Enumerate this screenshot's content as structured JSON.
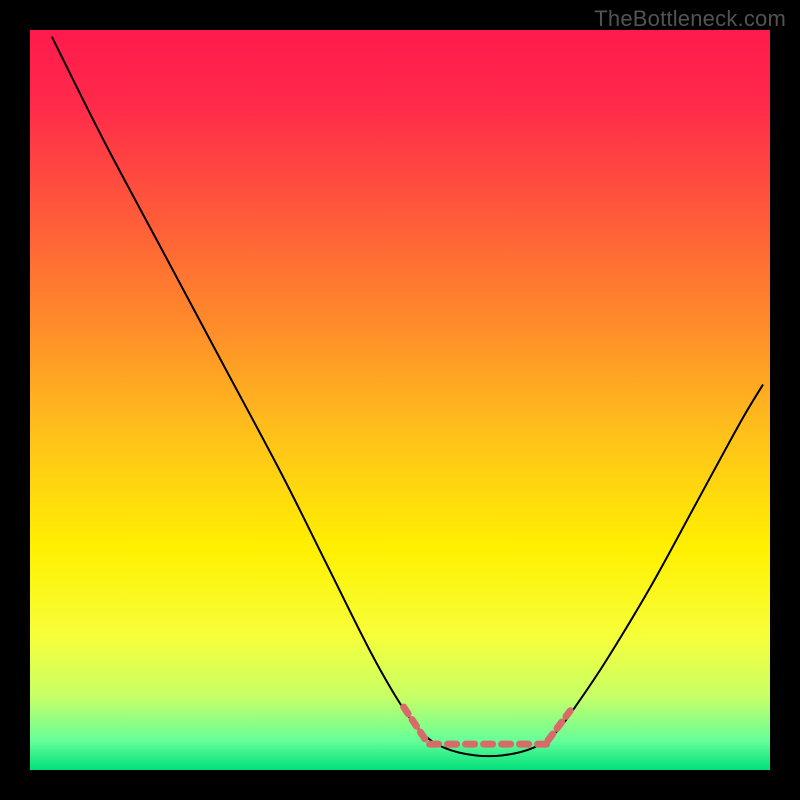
{
  "watermark": "TheBottleneck.com",
  "colors": {
    "gradient_stops": [
      {
        "offset": 0.0,
        "color": "#ff1a4d"
      },
      {
        "offset": 0.1,
        "color": "#ff2a4a"
      },
      {
        "offset": 0.25,
        "color": "#ff5a3a"
      },
      {
        "offset": 0.4,
        "color": "#ff8c2a"
      },
      {
        "offset": 0.55,
        "color": "#ffc21a"
      },
      {
        "offset": 0.7,
        "color": "#fff000"
      },
      {
        "offset": 0.82,
        "color": "#f6ff3a"
      },
      {
        "offset": 0.9,
        "color": "#c8ff66"
      },
      {
        "offset": 0.96,
        "color": "#66ff99"
      },
      {
        "offset": 1.0,
        "color": "#00e07a"
      }
    ],
    "curve": "#000000",
    "overlay_marker": "#d86a6a",
    "frame": "#000000"
  },
  "chart_data": {
    "type": "line",
    "title": "",
    "xlabel": "",
    "ylabel": "",
    "xlim": [
      0,
      100
    ],
    "ylim": [
      0,
      100
    ],
    "series": [
      {
        "name": "bottleneck-curve",
        "points": [
          {
            "x": 3,
            "y": 99
          },
          {
            "x": 10,
            "y": 85
          },
          {
            "x": 18,
            "y": 70
          },
          {
            "x": 26,
            "y": 55
          },
          {
            "x": 34,
            "y": 40
          },
          {
            "x": 40,
            "y": 28
          },
          {
            "x": 46,
            "y": 16
          },
          {
            "x": 50,
            "y": 9
          },
          {
            "x": 53,
            "y": 5
          },
          {
            "x": 56,
            "y": 3
          },
          {
            "x": 60,
            "y": 2
          },
          {
            "x": 64,
            "y": 2
          },
          {
            "x": 68,
            "y": 3
          },
          {
            "x": 71,
            "y": 5
          },
          {
            "x": 74,
            "y": 9
          },
          {
            "x": 78,
            "y": 15
          },
          {
            "x": 84,
            "y": 25
          },
          {
            "x": 90,
            "y": 36
          },
          {
            "x": 96,
            "y": 47
          },
          {
            "x": 99,
            "y": 52
          }
        ]
      }
    ],
    "annotations": {
      "flat_zone": {
        "x_start": 53,
        "x_end": 71,
        "y": 3
      }
    }
  }
}
